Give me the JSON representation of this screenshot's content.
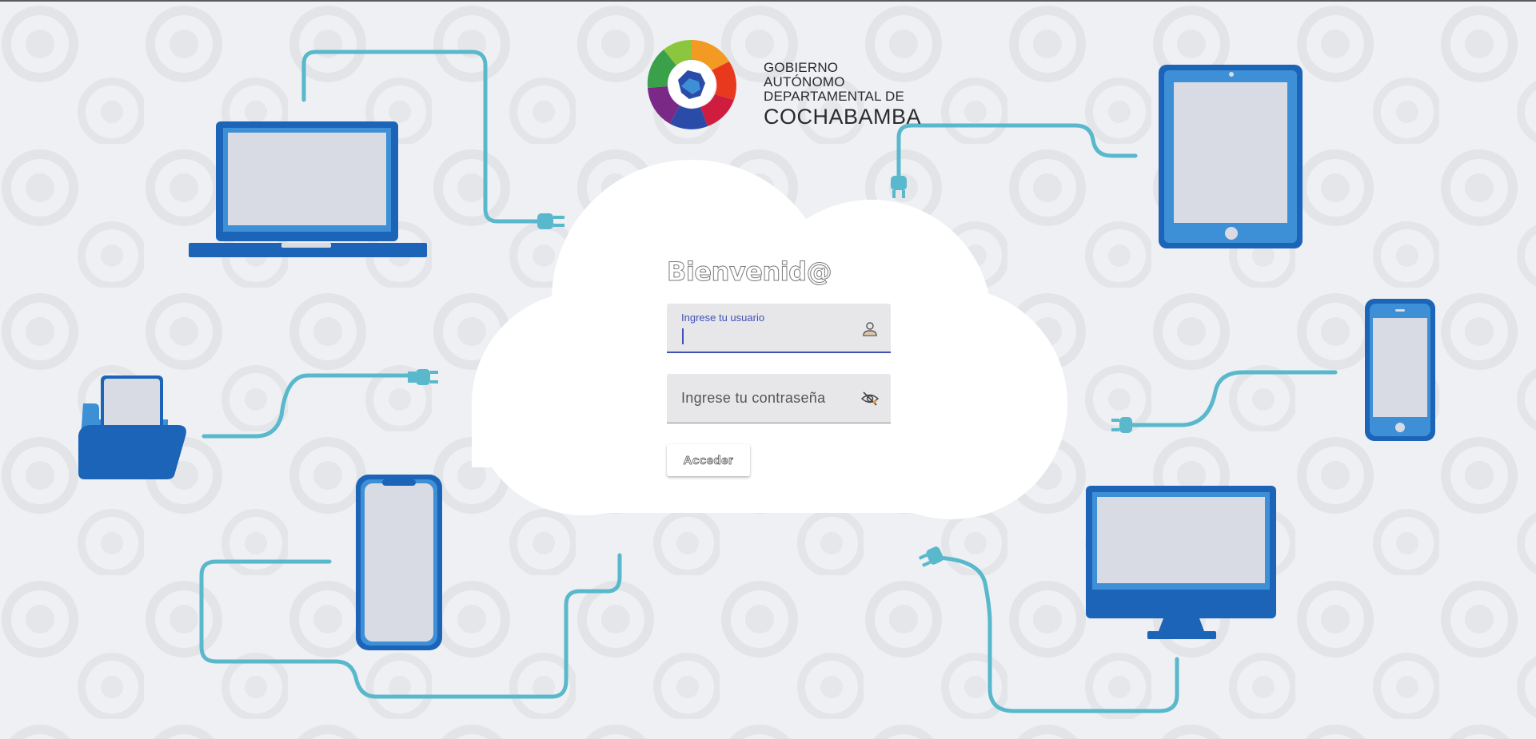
{
  "logo": {
    "line1": "GOBIERNO AUTÓNOMO",
    "line2": "DEPARTAMENTAL DE",
    "line3": "COCHABAMBA"
  },
  "login": {
    "title": "Bienvenid@",
    "username": {
      "label": "Ingrese tu usuario",
      "value": ""
    },
    "password": {
      "placeholder": "Ingrese tu contraseña"
    },
    "submit_label": "Acceder"
  },
  "colors": {
    "device_blue_dark": "#1b64b8",
    "device_blue_mid": "#3d8fd6",
    "screen": "#d8dbe4",
    "cable": "#5ab8cc",
    "accent": "#3f51b5"
  },
  "icons": {
    "username": "user-icon",
    "password": "eye-off-icon"
  }
}
